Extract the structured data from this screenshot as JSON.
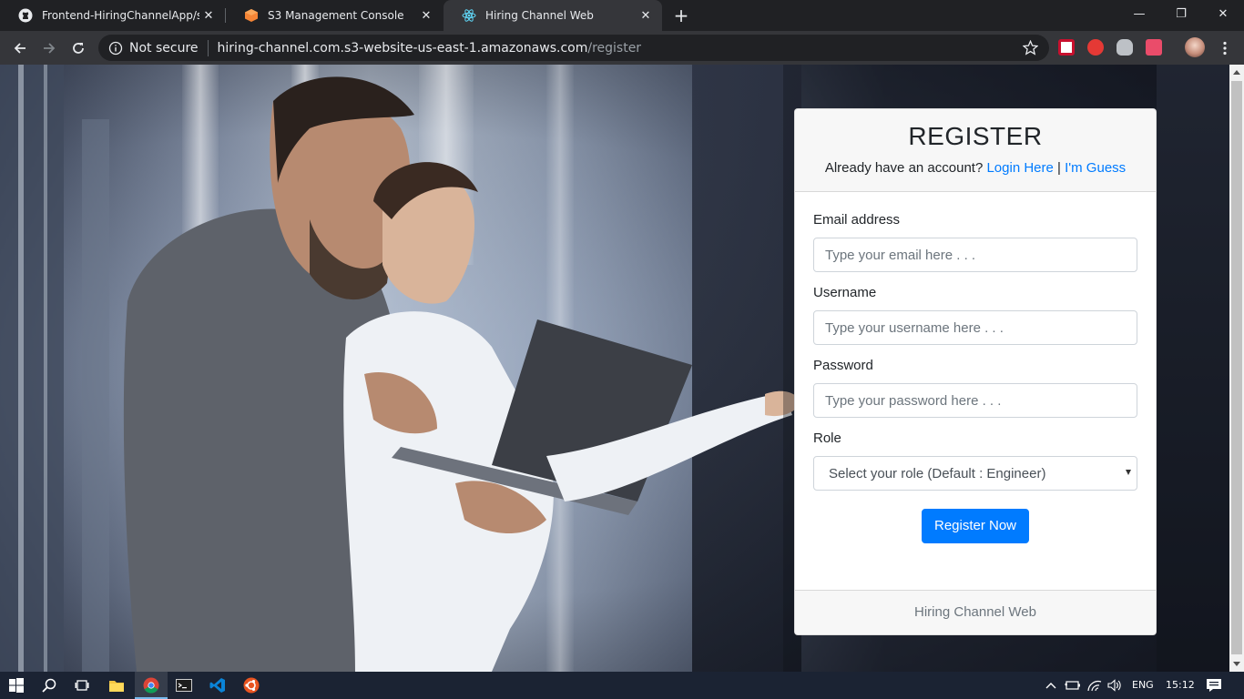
{
  "browser": {
    "tabs": [
      {
        "title": "Frontend-HiringChannelApp/src/",
        "active": false
      },
      {
        "title": "S3 Management Console",
        "active": false
      },
      {
        "title": "Hiring Channel Web",
        "active": true
      }
    ],
    "security_label": "Not secure",
    "url_host": "hiring-channel.com.s3-website-us-east-1.amazonaws.com",
    "url_path": "/register"
  },
  "register": {
    "title": "REGISTER",
    "have_account": "Already have an account?",
    "login_link": "Login Here",
    "separator": "|",
    "guest_link": "I'm Guess",
    "email_label": "Email address",
    "email_placeholder": "Type your email here . . .",
    "username_label": "Username",
    "username_placeholder": "Type your username here . . .",
    "password_label": "Password",
    "password_placeholder": "Type your password here . . .",
    "role_label": "Role",
    "role_selected": "Select your role (Default : Engineer)",
    "submit_label": "Register Now",
    "footer": "Hiring Channel Web"
  },
  "taskbar": {
    "language": "ENG",
    "time": "15:12"
  },
  "colors": {
    "primary": "#007bff",
    "tab_active": "#35363a",
    "chrome_dark": "#202124",
    "taskbar": "#1b2333"
  }
}
